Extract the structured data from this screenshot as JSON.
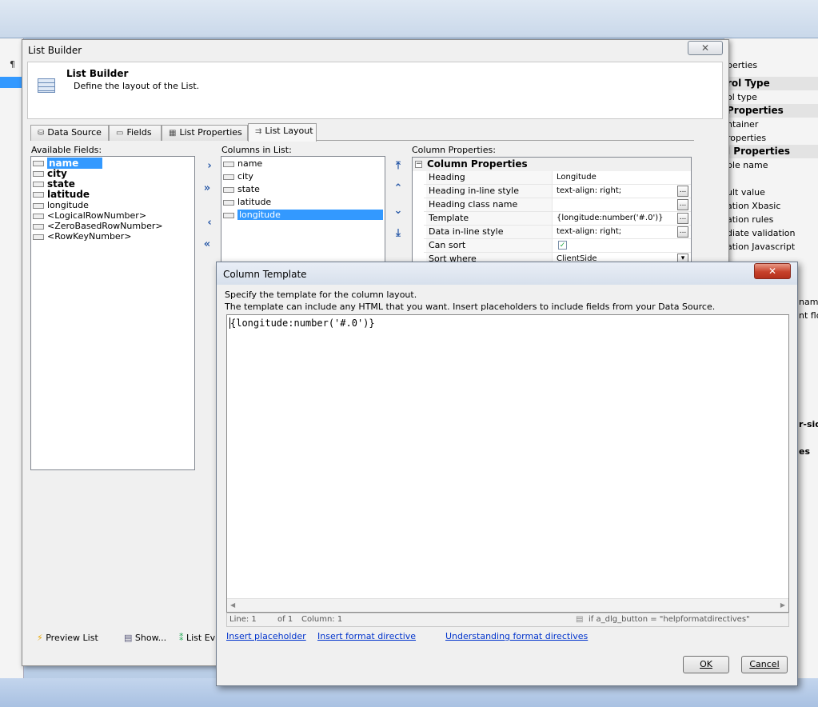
{
  "background": {
    "pilcrow": "¶",
    "right_panel_rows": [
      {
        "text": "perties",
        "header": false
      },
      {
        "text": "rol Type",
        "header": true
      },
      {
        "text": "ol type",
        "header": false
      },
      {
        "text": "Properties",
        "header": true
      },
      {
        "text": "ntainer",
        "header": false
      },
      {
        "text": "roperties",
        "header": false
      },
      {
        "text": "l Properties",
        "header": true
      },
      {
        "text": "ble name",
        "header": false
      },
      {
        "text": "",
        "header": false
      },
      {
        "text": "ult value",
        "header": false
      },
      {
        "text": "ation Xbasic",
        "header": false
      },
      {
        "text": "ation rules",
        "header": false
      },
      {
        "text": "diate validation",
        "header": false
      },
      {
        "text": "ation Javascript",
        "header": false
      }
    ],
    "right_panel_fragments": [
      "name",
      "nt floa",
      "r-side",
      "es"
    ]
  },
  "list_builder": {
    "window_title": "List Builder",
    "close_glyph": "✕",
    "header_title": "List Builder",
    "header_subtitle": "Define the layout of the List.",
    "tabs": [
      "Data Source",
      "Fields",
      "List Properties",
      "List Layout"
    ],
    "available_label": "Available Fields:",
    "available_fields": [
      {
        "name": "name",
        "bold": true,
        "selected": true
      },
      {
        "name": "city",
        "bold": true,
        "selected": false
      },
      {
        "name": "state",
        "bold": true,
        "selected": false
      },
      {
        "name": "latitude",
        "bold": true,
        "selected": false
      },
      {
        "name": "longitude",
        "bold": false,
        "selected": false
      },
      {
        "name": "<LogicalRowNumber>",
        "bold": false,
        "selected": false
      },
      {
        "name": "<ZeroBasedRowNumber>",
        "bold": false,
        "selected": false
      },
      {
        "name": "<RowKeyNumber>",
        "bold": false,
        "selected": false
      }
    ],
    "move_buttons": [
      "›",
      "»",
      "‹",
      "«"
    ],
    "columns_label": "Columns in List:",
    "columns": [
      {
        "name": "name",
        "selected": false
      },
      {
        "name": "city",
        "selected": false
      },
      {
        "name": "state",
        "selected": false
      },
      {
        "name": "latitude",
        "selected": false
      },
      {
        "name": "longitude",
        "selected": true
      }
    ],
    "order_buttons": [
      "⤒",
      "⌃",
      "⌄",
      "⤓"
    ],
    "props_label": "Column Properties:",
    "props_group": "Column Properties",
    "props": [
      {
        "name": "Heading",
        "value": "Longitude",
        "ellipsis": false
      },
      {
        "name": "Heading in-line style",
        "value": "text-align: right;",
        "ellipsis": true
      },
      {
        "name": "Heading class name",
        "value": "",
        "ellipsis": true
      },
      {
        "name": "Template",
        "value": "{longitude:number('#.0')}",
        "ellipsis": true
      },
      {
        "name": "Data in-line style",
        "value": "text-align: right;",
        "ellipsis": true
      },
      {
        "name": "Can sort",
        "value": "✓",
        "ellipsis": false
      },
      {
        "name": "Sort where",
        "value": "ClientSide",
        "ellipsis": false
      }
    ],
    "footer": [
      "Preview List",
      "Show...",
      "List Ev"
    ]
  },
  "column_template": {
    "title": "Column Template",
    "close_glyph": "✕",
    "desc1": "Specify the template for the column layout.",
    "desc2": "The template can include any HTML that you want. Insert placeholders to include fields from your Data Source.",
    "editor_text": "{longitude:number('#.0')}",
    "status_line": "Line: 1",
    "status_of": "of 1",
    "status_column": "Column: 1",
    "status_right": "if a_dlg_button = \"helpformatdirectives\"",
    "links": [
      "Insert placeholder",
      "Insert format directive",
      "Understanding format directives"
    ],
    "ok_label": "OK",
    "cancel_label": "Cancel"
  }
}
